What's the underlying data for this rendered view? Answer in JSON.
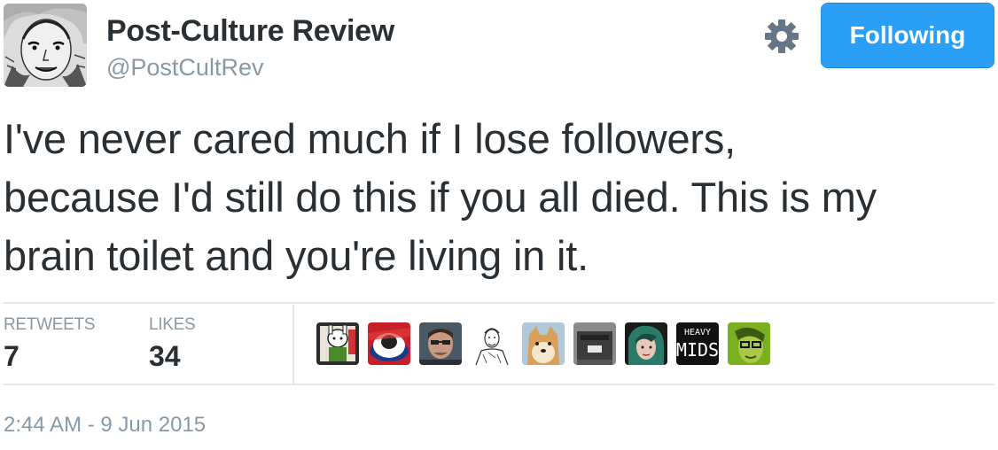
{
  "author": {
    "display_name": "Post-Culture Review",
    "handle": "@PostCultRev",
    "avatar_icon": "sketch-face-avatar"
  },
  "header": {
    "gear_icon": "gear-icon",
    "follow_label": "Following",
    "follow_color": "#2b9ff5"
  },
  "tweet": {
    "lines": [
      "I've never cared much if I lose followers,",
      "because I'd still do this if you all died. This is my",
      "brain toilet and you're living in it."
    ]
  },
  "stats": {
    "retweets_label": "RETWEETS",
    "retweets_value": "7",
    "likes_label": "LIKES",
    "likes_value": "34"
  },
  "likers": [
    {
      "icon": "cartoon-character-avatar",
      "color": "#3a5a2a"
    },
    {
      "icon": "red-white-avatar",
      "color": "#c8202a"
    },
    {
      "icon": "man-photo-avatar",
      "color": "#4a5866"
    },
    {
      "icon": "sketch-man-avatar",
      "color": "#ffffff"
    },
    {
      "icon": "shiba-dog-avatar",
      "color": "#d9a05a"
    },
    {
      "icon": "dark-object-avatar",
      "color": "#3c3c3c"
    },
    {
      "icon": "woman-photo-avatar",
      "color": "#2a7a6a"
    },
    {
      "icon": "heavy-mids-text-avatar",
      "color": "#111111",
      "text_top": "HEAVY",
      "text_bottom": "MIDS"
    },
    {
      "icon": "green-face-avatar",
      "color": "#7ab020"
    }
  ],
  "timestamp": "2:44 AM - 9 Jun 2015"
}
